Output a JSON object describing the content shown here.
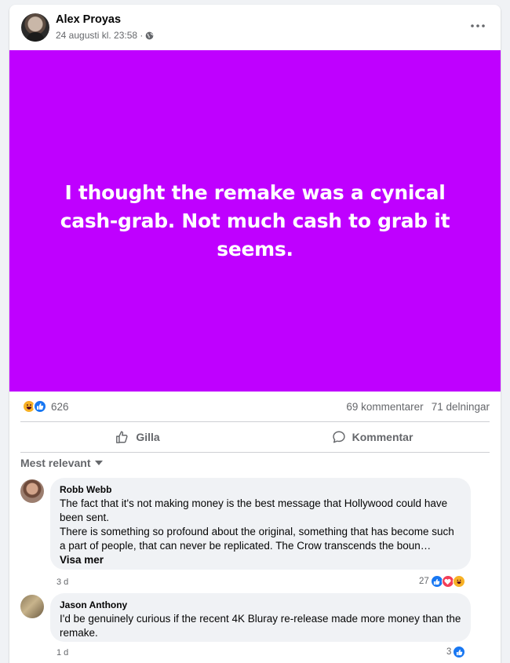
{
  "post": {
    "author": "Alex Proyas",
    "timestamp": "24 augusti kl. 23:58 ·",
    "visibility_icon": "globe-icon",
    "text": "I thought the remake was a cynical cash-grab. Not much cash to grab it seems.",
    "background_color": "#bf00ff"
  },
  "stats": {
    "reaction_count": "626",
    "comments": "69 kommentarer",
    "shares": "71 delningar"
  },
  "actions": {
    "like_label": "Gilla",
    "comment_label": "Kommentar"
  },
  "sort": {
    "label": "Mest relevant"
  },
  "comments": [
    {
      "name": "Robb Webb",
      "text_line1": "The fact that it's not making money is the best message that Hollywood could have been sent.",
      "text_line2": "There is something so profound about the original, something that has become such a part of people, that can never be replicated. The Crow transcends the boun…",
      "see_more": "Visa mer",
      "time": "3 d",
      "reaction_count": "27"
    },
    {
      "name": "Jason Anthony",
      "text_line1": "I'd be genuinely curious if the recent 4K Bluray re-release made more money than the remake.",
      "time": "1 d",
      "reaction_count": "3"
    }
  ]
}
